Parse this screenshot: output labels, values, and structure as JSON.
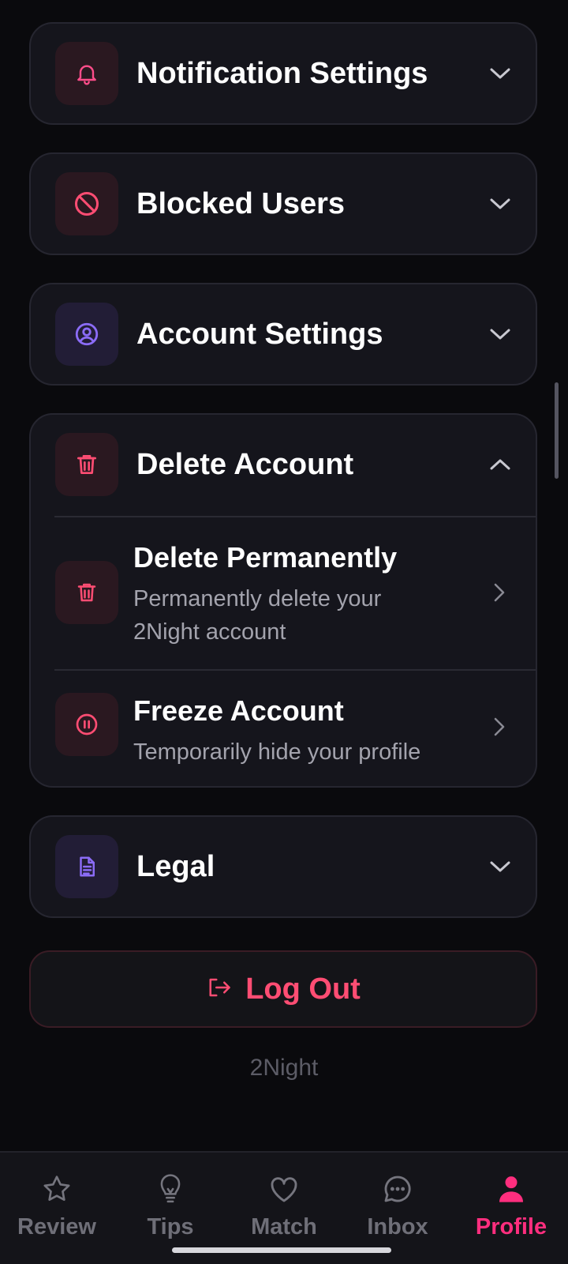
{
  "sections": {
    "notifications": {
      "title": "Notification Settings",
      "icon": "bell-icon"
    },
    "blocked": {
      "title": "Blocked Users",
      "icon": "block-icon"
    },
    "account": {
      "title": "Account Settings",
      "icon": "user-circle-icon"
    },
    "delete": {
      "title": "Delete Account",
      "icon": "trash-icon",
      "expanded": true,
      "items": [
        {
          "title": "Delete Permanently",
          "description": "Permanently delete your 2Night account",
          "icon": "trash-icon"
        },
        {
          "title": "Freeze Account",
          "description": "Temporarily hide your profile",
          "icon": "pause-circle-icon"
        }
      ]
    },
    "legal": {
      "title": "Legal",
      "icon": "document-icon"
    }
  },
  "logout": {
    "label": "Log Out",
    "icon": "logout-icon"
  },
  "brand": "2Night",
  "nav": {
    "items": [
      {
        "label": "Review",
        "icon": "star-icon"
      },
      {
        "label": "Tips",
        "icon": "lightbulb-icon"
      },
      {
        "label": "Match",
        "icon": "heart-icon"
      },
      {
        "label": "Inbox",
        "icon": "chat-icon"
      },
      {
        "label": "Profile",
        "icon": "person-icon"
      }
    ],
    "active": "Profile"
  },
  "colors": {
    "accent": "#ff2e7e",
    "danger": "#ff4d73",
    "purple": "#8b6cf6",
    "background": "#0a0a0d",
    "card": "#15151c"
  }
}
